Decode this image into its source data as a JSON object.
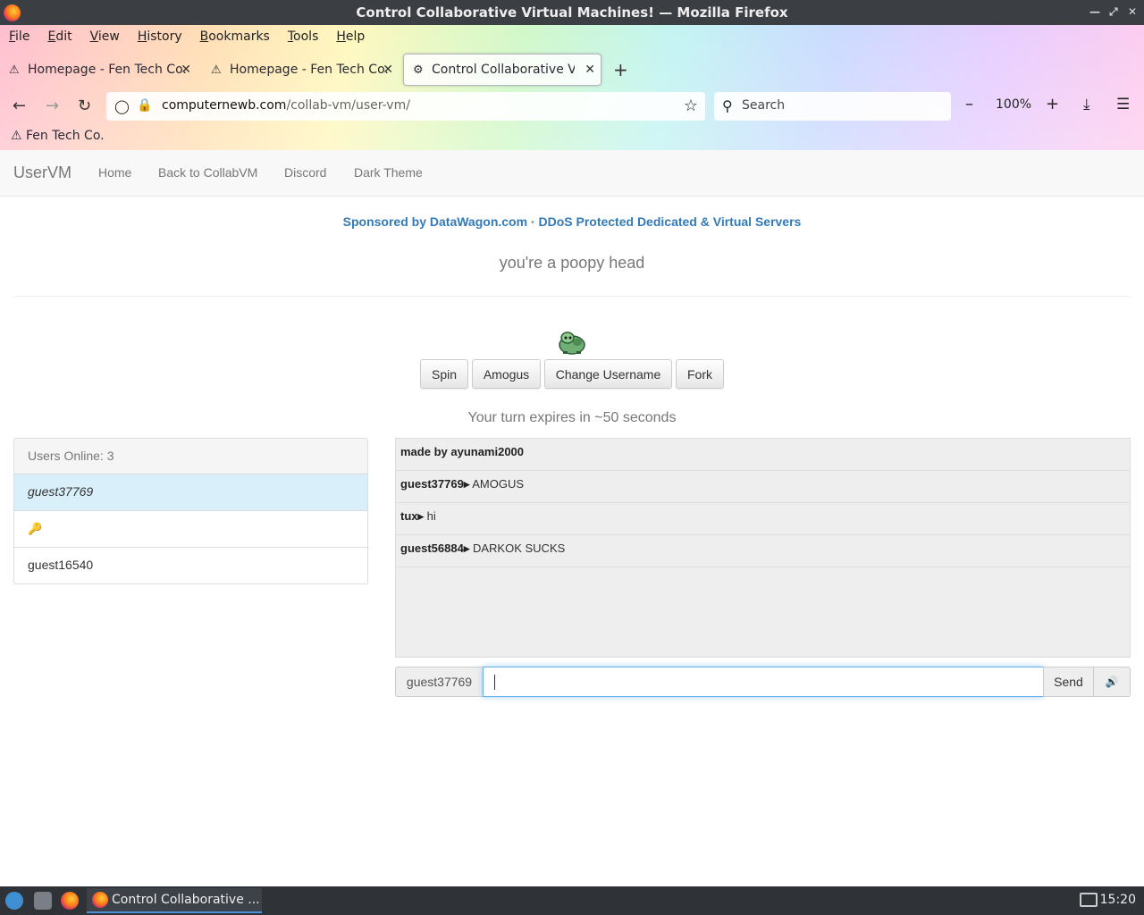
{
  "window": {
    "title": "Control Collaborative Virtual Machines! — Mozilla Firefox"
  },
  "menu": [
    "File",
    "Edit",
    "View",
    "History",
    "Bookmarks",
    "Tools",
    "Help"
  ],
  "tabs": [
    {
      "label": "Homepage - Fen Tech Co.",
      "active": false
    },
    {
      "label": "Homepage - Fen Tech Co.",
      "active": false
    },
    {
      "label": "Control Collaborative Virt",
      "active": true
    }
  ],
  "nav": {
    "url_host": "computernewb.com",
    "url_path": "/collab-vm/user-vm/",
    "search_placeholder": "Search",
    "zoom": "100%"
  },
  "bookmarks": [
    {
      "label": "Fen Tech Co."
    }
  ],
  "site": {
    "brand": "UserVM",
    "links": [
      "Home",
      "Back to CollabVM",
      "Discord",
      "Dark Theme"
    ],
    "sponsor": "Sponsored by DataWagon.com · DDoS Protected Dedicated & Virtual Servers",
    "motd": "you're a poopy head",
    "buttons": [
      "Spin",
      "Amogus",
      "Change Username",
      "Fork"
    ],
    "turn_text": "Your turn expires in ~50 seconds"
  },
  "users": {
    "header": "Users Online: 3",
    "list": [
      "guest37769",
      "",
      "guest16540"
    ]
  },
  "chat": {
    "messages": [
      {
        "user": "made by ayunami2000",
        "text": ""
      },
      {
        "user": "guest37769",
        "text": "AMOGUS"
      },
      {
        "user": "tux",
        "text": "hi"
      },
      {
        "user": "guest56884",
        "text": "DARKOK SUCKS"
      }
    ],
    "username": "guest37769",
    "input_value": "",
    "send_label": "Send"
  },
  "taskbar": {
    "task_label": "Control Collaborative ...",
    "clock": "15:20"
  }
}
